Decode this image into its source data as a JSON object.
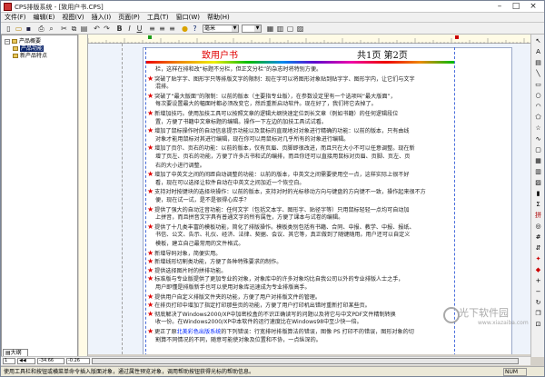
{
  "window": {
    "title": "CPS排版系统 - [致用户书.CPS]",
    "controls": [
      "–",
      "□",
      "×"
    ]
  },
  "menubar": [
    "文件(F)",
    "编辑(E)",
    "视图(V)",
    "插入(I)",
    "页面(P)",
    "工具(T)",
    "窗口(W)",
    "帮助(H)"
  ],
  "toolbar": {
    "zoom": "毫米",
    "font_size": "",
    "icons": [
      "new-icon",
      "open-icon",
      "save-icon",
      "print-icon",
      "preview-icon",
      "cut-icon",
      "copy-icon",
      "paste-icon",
      "undo-icon",
      "redo-icon",
      "bold-icon",
      "italic-icon",
      "underline-icon",
      "align-left-icon",
      "align-center-icon",
      "align-right-icon",
      "bulb-icon",
      "help-icon"
    ]
  },
  "tree": [
    {
      "label": "产品概要",
      "level": 0,
      "toggle": "−"
    },
    {
      "label": "产品功能",
      "level": 1,
      "toggle": "",
      "selected": true
    },
    {
      "label": "新产品特点",
      "level": 1,
      "toggle": ""
    }
  ],
  "left_tab": "大纲",
  "document": {
    "header_left": "致用户书",
    "header_right": "共1页 第2页",
    "lines": [
      {
        "star": false,
        "text": "栏，这样在排和改“标题不分栏，但正文分栏”的杂志时将特别方便。"
      },
      {
        "star": true,
        "text": "突破了贴字字、图形字只等排版文字的限制：现在字可以将图形对象贴到贴字字、图形字内，让它们与文字"
      },
      {
        "star": false,
        "text": "混排。"
      },
      {
        "star": true,
        "text": "突破了“最大版面”的限制：以前的版本（主要指专业版），在参数设定里有一个选项叫“最大版面”，"
      },
      {
        "star": false,
        "text": "每次要设置最大的幅面时都必须改变它，然后重新启动软件。现在好了，我们将它去掉了。"
      },
      {
        "star": true,
        "text": "新增加技巧。使用加技工具可以按照文章的逻辑大纲快速定位到长文章（例如书籍）的任何逻辑段位"
      },
      {
        "star": false,
        "text": "置，方便了书籍中文章标题的编辑。操作一下左边的加技工具试试看。"
      },
      {
        "star": true,
        "text": "增加了鼠标操作时的自动信息提示功能以及鼠标的直观地对对象进行精确的功能：以前的版本，只有由线"
      },
      {
        "star": false,
        "text": "对象才能用鼠标对其进行编辑，现在你可以用鼠标对几乎所有的对象进行编辑。"
      },
      {
        "star": true,
        "text": "增加了页尔、页右的功能：以前的版本，仅有页眉、页脚即很改进，而且只在大小不可以任意调整。现在新"
      },
      {
        "star": false,
        "text": "增了页左、页右的功能，方便了许多古书和式的编排，而且你还可以直接用鼠标对页眉、页脚、页左、页"
      },
      {
        "star": false,
        "text": "右的大小进行调整。"
      },
      {
        "star": true,
        "text": "增加了中英文之间的间距自动调整的功能：以前的版本，中英文之间需要使用空一点，这样实际上很不好"
      },
      {
        "star": false,
        "text": "看，现在可以选择让软件自动在中英文之间加近一个恢空白。"
      },
      {
        "star": true,
        "text": "支持对时按键块的选择块操作：以前的版本，支持对时的光标移动方向与键盘的方向键不一致，操作起来很不方"
      },
      {
        "star": false,
        "text": "便，现在试一试，是不是很得心应手？"
      },
      {
        "star": true,
        "text": "提供了强大的自动注音功能：任何文字（包括文本字、图形字、贴径字等）只用鼠标轻轻一点均可自动加"
      },
      {
        "star": false,
        "text": "上拼音，而且拼音文字具有普通文字的所有属性，方便了课本与试卷的编辑。"
      },
      {
        "star": true,
        "text": "提供了十几类丰富的模板功能，简化了排版操作。模板类别包括有书籍、合同、中报、教学、中报、报纸、"
      },
      {
        "star": false,
        "text": "书信、公文、告示、礼仪、经济、法律、契据、会议、其它等，真正做到了随键随用。用户还可以自定义"
      },
      {
        "star": false,
        "text": "模板，建立自己最常用的文件格式。"
      },
      {
        "star": true,
        "text": "新增导码对象，简便实用。"
      },
      {
        "star": true,
        "text": "新增线形切割类功能，方便了各种特殊要求的制作。"
      },
      {
        "star": true,
        "text": "提供选择图片时的拼排功能。"
      },
      {
        "star": true,
        "text": "标准版与专业版提供了更加专业的对象，对象库中的许多对象均比自我公司以外的专业排版人士之手，"
      },
      {
        "star": false,
        "text": "用户即懂是排版新手也可以使用对象库迅速成为专业排版高手。"
      },
      {
        "star": true,
        "text": "提供用户自定义排版文件夹的功能，方便了用户对排版文件的管理。"
      },
      {
        "star": true,
        "text": "在排页打印中增加了指定打印那些页的功能，方便了用户打印机出错时重新打印某些页。"
      },
      {
        "star": true,
        "text": "彻底解决了Windows2000/XP中加密校盒的不识正确读写的问题以及将它与中文PDF文件精制转换"
      },
      {
        "star": false,
        "text": "收一份。在Windows2000/XP中本软件的运行速度比在Windows98中至少快一倍。"
      },
      {
        "star": true,
        "text": "更正了原北美彩色出版系统的下列错误：行宽排时排版算法的错误，图像 PS 打印不的错误，图形对象的切",
        "link": "北美彩色出版系统"
      },
      {
        "star": false,
        "text": "割算不同情况的不同，随意可能使对象及位置和不协，一点纵深的。"
      }
    ]
  },
  "hscroll": {
    "page": "1",
    "x": "-34.66",
    "y": "-0.26"
  },
  "status": {
    "text": "使用工具栏和按钮或横菜单命令插入版面对象，通过属性预览对象，调用帮助按钮获得光标的帮助信息。",
    "mode": "NUM"
  },
  "watermark": {
    "text": "光下软件园",
    "sub": "www.xiazaiba.com"
  }
}
